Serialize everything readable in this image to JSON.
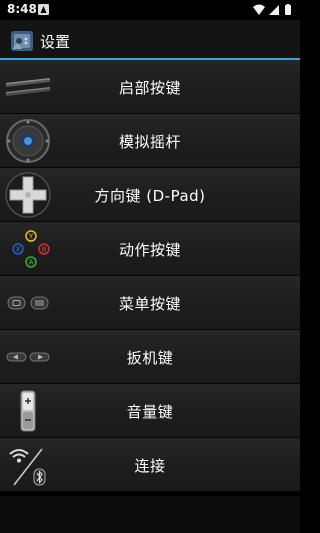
{
  "status_bar": {
    "time": "8:48",
    "notification_icon": "android-notification-icon",
    "icons": [
      "wifi-icon",
      "signal-icon",
      "battery-icon"
    ]
  },
  "action_bar": {
    "title": "设置",
    "icon": "app-controller-icon",
    "accent_color": "#33a6d8"
  },
  "menu": {
    "items": [
      {
        "label": "启部按键",
        "icon": "start-select-buttons-icon"
      },
      {
        "label": "模拟摇杆",
        "icon": "analog-stick-icon"
      },
      {
        "label": "方向键 (D-Pad)",
        "icon": "dpad-icon"
      },
      {
        "label": "动作按键",
        "icon": "action-buttons-icon"
      },
      {
        "label": "菜单按键",
        "icon": "menu-buttons-icon"
      },
      {
        "label": "扳机键",
        "icon": "trigger-buttons-icon"
      },
      {
        "label": "音量键",
        "icon": "volume-key-icon"
      },
      {
        "label": "连接",
        "icon": "wifi-bluetooth-icon"
      }
    ]
  },
  "action_button_colors": {
    "y": "#e0c020",
    "x": "#2060d0",
    "b": "#d03030",
    "a": "#30b030"
  }
}
